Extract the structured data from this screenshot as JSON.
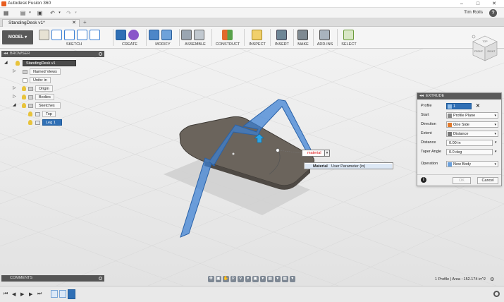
{
  "app": {
    "title": "Autodesk Fusion 360",
    "user": "Tim Rolls",
    "help": "?"
  },
  "document": {
    "tab_title": "StandingDesk v1*"
  },
  "toolbar": {
    "mode": "MODEL",
    "groups": [
      "SKETCH",
      "CREATE",
      "MODIFY",
      "ASSEMBLE",
      "CONSTRUCT",
      "INSPECT",
      "INSERT",
      "MAKE",
      "ADD-INS",
      "SELECT"
    ]
  },
  "browser": {
    "header": "BROWSER",
    "root": "StandingDesk v1",
    "items": [
      "Named Views",
      "Units: in",
      "Origin",
      "Bodies",
      "Sketches",
      "Top",
      "Leg 1"
    ]
  },
  "extrude": {
    "header": "EXTRUDE",
    "profile_label": "Profile",
    "profile_value": "1 selected",
    "start_label": "Start",
    "start_value": "Profile Plane",
    "direction_label": "Direction",
    "direction_value": "One Side",
    "extent_label": "Extent",
    "extent_value": "Distance",
    "distance_label": "Distance",
    "distance_value": "0.00 in",
    "taper_label": "Taper Angle",
    "taper_value": "0.0 deg",
    "operation_label": "Operation",
    "operation_value": "New Body",
    "ok_label": "OK",
    "cancel_label": "Cancel"
  },
  "canvas": {
    "distance_input": "material",
    "suggestion_name": "Material",
    "suggestion_type": "User Parameter (in)"
  },
  "viewcube": {
    "faces": [
      "TOP",
      "FRONT",
      "RIGHT"
    ]
  },
  "comments": {
    "header": "COMMENTS"
  },
  "status": {
    "text": "1 Profile | Area : 152.174 in^2"
  },
  "colors": {
    "accent": "#2f6fb5",
    "body": "#6b645c",
    "sketch": "#3a7fd4"
  }
}
